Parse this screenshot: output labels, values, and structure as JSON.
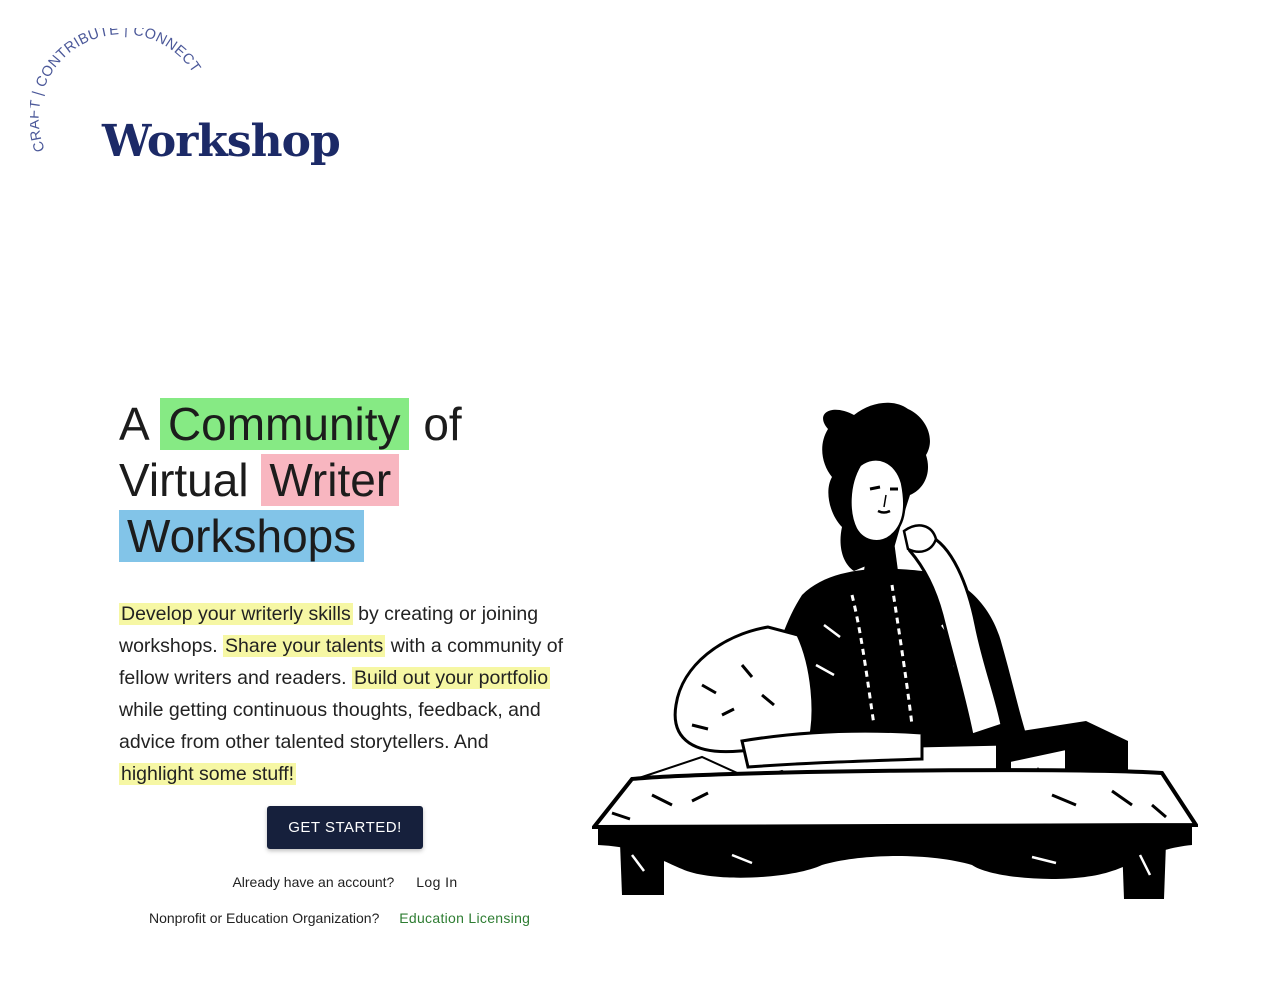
{
  "logo": {
    "arc_text": "CRAFT | CONTRIBUTE | CONNECT",
    "wordmark": "Workshop",
    "color": "#1c2a67"
  },
  "hero": {
    "headline": {
      "prefix": "A",
      "word_community": "Community",
      "word_of": "of",
      "word_virtual": "Virtual",
      "word_writer": "Writer",
      "word_workshops": "Workshops"
    },
    "intro": {
      "p1_highlight": "Develop your writerly skills",
      "p1_rest": " by creating or joining workshops. ",
      "p2_highlight": "Share your talents",
      "p2_rest": " with a community of fellow writers and readers. ",
      "p3_highlight": "Build out your portfolio",
      "p3_rest": " while getting continuous thoughts, feedback, and advice from other talented storytellers. And ",
      "p4_highlight": "highlight some stuff!"
    },
    "highlight_colors": {
      "green": "#86ea84",
      "pink": "#f8b6c0",
      "blue": "#82c4e8",
      "yellow": "#f6f7a4"
    }
  },
  "cta": {
    "label": "GET STARTED!",
    "color": "#16203c"
  },
  "login": {
    "question": "Already have an account?",
    "link_label": "Log In"
  },
  "education": {
    "question": "Nonprofit or Education Organization?",
    "link_label": "Education Licensing",
    "link_color": "#2e7d32"
  },
  "illustration": {
    "icon": "woman-at-writing-desk-illustration"
  }
}
